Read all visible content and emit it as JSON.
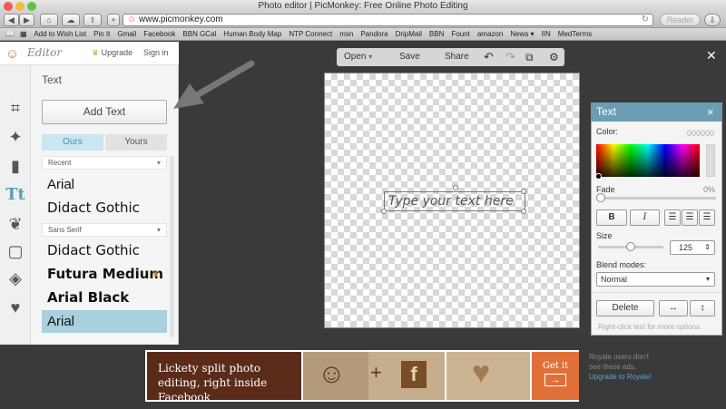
{
  "browser": {
    "window_title": "Photo editor | PicMonkey: Free Online Photo Editing",
    "url": "www.picmonkey.com",
    "reader_label": "Reader",
    "bookmarks": [
      "Add to Wish List",
      "Pin It",
      "Gmail",
      "Facebook",
      "BBN GCal",
      "Human Body Map",
      "NTP Connect",
      "msn",
      "Pandora",
      "DripMail",
      "BBN",
      "Fount",
      "amazon",
      "News ▾",
      "IIN",
      "MedTerms"
    ]
  },
  "header": {
    "logo_text": "Editor",
    "upgrade_label": "Upgrade",
    "signin_label": "Sign in"
  },
  "sidebar": {
    "section_title": "Text",
    "add_text_label": "Add Text",
    "tabs": [
      "Ours",
      "Yours"
    ],
    "recent_label": "Recent",
    "sans_serif_label": "Sans Serif",
    "fonts_recent": [
      "Arial",
      "Didact Gothic"
    ],
    "fonts_sans": [
      "Didact Gothic",
      "Futura Medium",
      "Arial Black",
      "Arial"
    ]
  },
  "toolbar": {
    "open_label": "Open",
    "save_label": "Save",
    "share_label": "Share"
  },
  "canvas": {
    "placeholder_text": "Type your text here"
  },
  "text_panel": {
    "title": "Text",
    "close_glyph": "×",
    "color_label": "Color:",
    "color_value": "000000",
    "fade_label": "Fade",
    "fade_value": "0%",
    "size_label": "Size",
    "size_value": "125",
    "blend_label": "Blend modes:",
    "blend_value": "Normal",
    "delete_label": "Delete",
    "hint": "Right-click text for more options."
  },
  "ad": {
    "headline": "Lickety split photo editing, right inside Facebook",
    "cta": "Get it",
    "side_text": "Royale users don't see these ads.",
    "upgrade_link": "Upgrade to Royale!"
  },
  "colors": {
    "accent": "#6a9db3",
    "selected_font_bg": "#a8d0de",
    "ad_brown": "#5b2b1a",
    "ad_orange": "#e0703a"
  }
}
